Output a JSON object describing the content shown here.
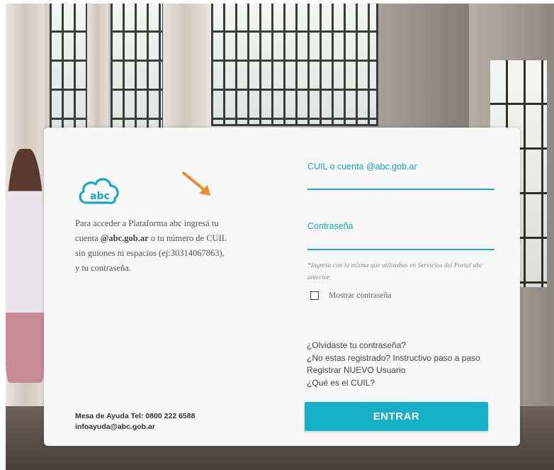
{
  "intro": {
    "line1": "Para acceder a Plataforma abc ingresá tu",
    "line2_prefix": "cuenta ",
    "line2_bold": "@abc.gob.ar",
    "line2_suffix": " o tu número de CUIL",
    "line3": "sin guiones ni espacios (ej:30314067863),",
    "line4": "y tu contraseña."
  },
  "logo": {
    "text": "abc"
  },
  "help": {
    "phone": "Mesa de Ayuda Tel: 0800 222 6588",
    "email": "infoayuda@abc.gob.ar"
  },
  "form": {
    "user_label": "CUIL o cuenta @abc.gob.ar",
    "user_value": "",
    "password_label": "Contraseña",
    "password_value": "",
    "note": "*Ingresa con la mizma que utilizabas en Servicios del Portal abc anterior.",
    "show_password_label": "Mostrar contraseña",
    "show_password_checked": false
  },
  "links": [
    "¿Olvidaste tu contraseña?",
    "¿No estas registrado? Instructivo paso a paso",
    "Registrar NUEVO Usuario",
    "¿Qué es el CUIL?"
  ],
  "submit_label": "ENTRAR",
  "colors": {
    "accent": "#14aec6",
    "arrow": "#f08a2a"
  }
}
